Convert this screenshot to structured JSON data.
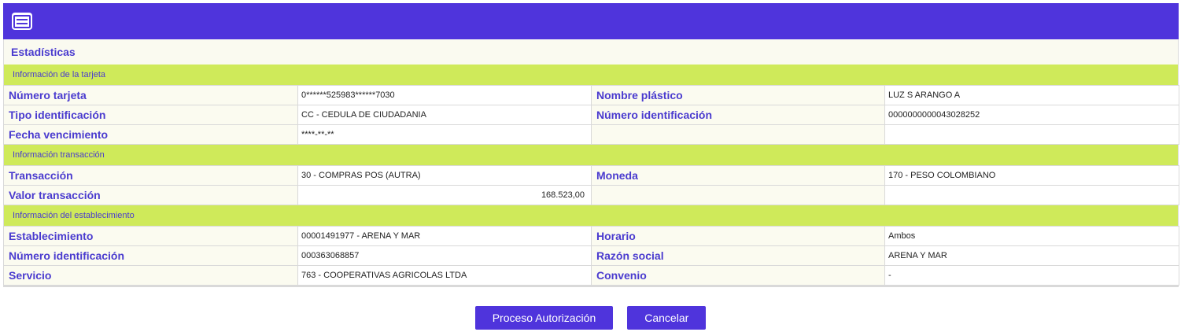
{
  "header": {
    "icon": "card-icon",
    "bar_color": "#4f34dc"
  },
  "page_title": "Estadísticas",
  "sections": {
    "card": {
      "title": "Información de la tarjeta",
      "rows": [
        {
          "l1": "Número tarjeta",
          "v1": "0******525983******7030",
          "l2": "Nombre plástico",
          "v2": "LUZ S ARANGO A"
        },
        {
          "l1": "Tipo identificación",
          "v1": "CC - CEDULA DE CIUDADANIA",
          "l2": "Número identificación",
          "v2": "0000000000043028252"
        },
        {
          "l1": "Fecha vencimiento",
          "v1": "****-**-**",
          "l2": "",
          "v2": ""
        }
      ]
    },
    "transaction": {
      "title": "Información transacción",
      "rows": [
        {
          "l1": "Transacción",
          "v1": "30 - COMPRAS POS (AUTRA)",
          "l2": "Moneda",
          "v2": "170 - PESO COLOMBIANO"
        },
        {
          "l1": "Valor transacción",
          "v1": "168.523,00",
          "l2": "",
          "v2": ""
        }
      ]
    },
    "establishment": {
      "title": "Información del establecimiento",
      "rows": [
        {
          "l1": "Establecimiento",
          "v1": "00001491977 - ARENA Y MAR",
          "l2": "Horario",
          "v2": "Ambos"
        },
        {
          "l1": "Número identificación",
          "v1": "000363068857",
          "l2": "Razón social",
          "v2": "ARENA Y MAR"
        },
        {
          "l1": "Servicio",
          "v1": "763 - COOPERATIVAS AGRICOLAS LTDA",
          "l2": "Convenio",
          "v2": "-"
        }
      ]
    }
  },
  "buttons": {
    "authorize": "Proceso Autorización",
    "cancel": "Cancelar"
  },
  "colors": {
    "accent": "#4f34dc",
    "section": "#cfea5a",
    "label_text": "#4a3bcf"
  }
}
